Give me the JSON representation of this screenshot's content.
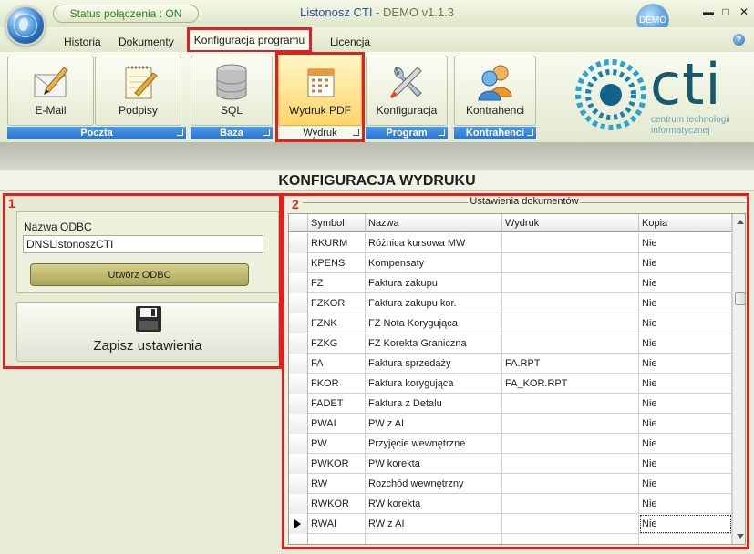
{
  "window": {
    "status": "Status połączenia : ON",
    "app_name": "Listonosz CTI",
    "edition": " - DEMO v1.1.3",
    "demo_badge": "DEMO",
    "min_glyph": "▬",
    "max_glyph": "□",
    "close_glyph": "✕"
  },
  "menu": {
    "tabs": [
      "Historia",
      "Dokumenty",
      "Konfiguracja programu",
      "Licencja"
    ],
    "help_glyph": "?"
  },
  "ribbon": {
    "buttons": [
      "E-Mail",
      "Podpisy",
      "SQL",
      "Wydruk PDF",
      "Konfiguracja",
      "Kontrahenci"
    ],
    "groups": [
      "Poczta",
      "Baza",
      "Wydruk",
      "Program",
      "Kontrahenci"
    ]
  },
  "logo": {
    "word": "cti",
    "subtitle_1": "centrum technologii",
    "subtitle_2": "informatycznej"
  },
  "section_title": "KONFIGURACJA WYDRUKU",
  "left_panel": {
    "number": "1",
    "odbc_label": "Nazwa ODBC",
    "odbc_value": "DNSListonoszCTI",
    "create_odbc": "Utwórz ODBC",
    "save": "Zapisz ustawienia"
  },
  "right_panel": {
    "number": "2",
    "legend": "Ustawienia dokumentów",
    "columns": [
      "Symbol",
      "Nazwa",
      "Wydruk",
      "Kopia"
    ],
    "rows": [
      {
        "symbol": "RKURM",
        "nazwa": "Różnica kursowa MW",
        "wydruk": "",
        "kopia": "Nie"
      },
      {
        "symbol": "KPENS",
        "nazwa": "Kompensaty",
        "wydruk": "",
        "kopia": "Nie"
      },
      {
        "symbol": "FZ",
        "nazwa": "Faktura zakupu",
        "wydruk": "",
        "kopia": "Nie"
      },
      {
        "symbol": "FZKOR",
        "nazwa": "Faktura zakupu kor.",
        "wydruk": "",
        "kopia": "Nie"
      },
      {
        "symbol": "FZNK",
        "nazwa": "FZ Nota Korygująca",
        "wydruk": "",
        "kopia": "Nie"
      },
      {
        "symbol": "FZKG",
        "nazwa": "FZ Korekta Graniczna",
        "wydruk": "",
        "kopia": "Nie"
      },
      {
        "symbol": "FA",
        "nazwa": "Faktura sprzedaży",
        "wydruk": "FA.RPT",
        "kopia": "Nie"
      },
      {
        "symbol": "FKOR",
        "nazwa": "Faktura korygująca",
        "wydruk": "FA_KOR.RPT",
        "kopia": "Nie"
      },
      {
        "symbol": "FADET",
        "nazwa": "Faktura z Detalu",
        "wydruk": "",
        "kopia": "Nie"
      },
      {
        "symbol": "PWAI",
        "nazwa": "PW z AI",
        "wydruk": "",
        "kopia": "Nie"
      },
      {
        "symbol": "PW",
        "nazwa": "Przyjęcie wewnętrzne",
        "wydruk": "",
        "kopia": "Nie"
      },
      {
        "symbol": "PWKOR",
        "nazwa": "PW korekta",
        "wydruk": "",
        "kopia": "Nie"
      },
      {
        "symbol": "RW",
        "nazwa": "Rozchód wewnętrzny",
        "wydruk": "",
        "kopia": "Nie"
      },
      {
        "symbol": "RWKOR",
        "nazwa": "RW korekta",
        "wydruk": "",
        "kopia": "Nie"
      },
      {
        "symbol": "RWAI",
        "nazwa": "RW z AI",
        "wydruk": "",
        "kopia": "Nie",
        "current": true
      }
    ]
  },
  "colors": {
    "accent_red": "#e02020",
    "ribbon_group_blue": "#2b72c9",
    "logo_teal": "#175a6a",
    "status_green": "#2f7d2f"
  },
  "icons": {
    "app": "globe-orb-icon",
    "email": "envelope-pen-icon",
    "signatures": "notepad-pen-icon",
    "sql": "database-icon",
    "print_pdf": "calendar-document-icon",
    "settings": "wrench-screwdriver-icon",
    "contractors": "users-icon",
    "save": "floppy-disk-icon"
  }
}
